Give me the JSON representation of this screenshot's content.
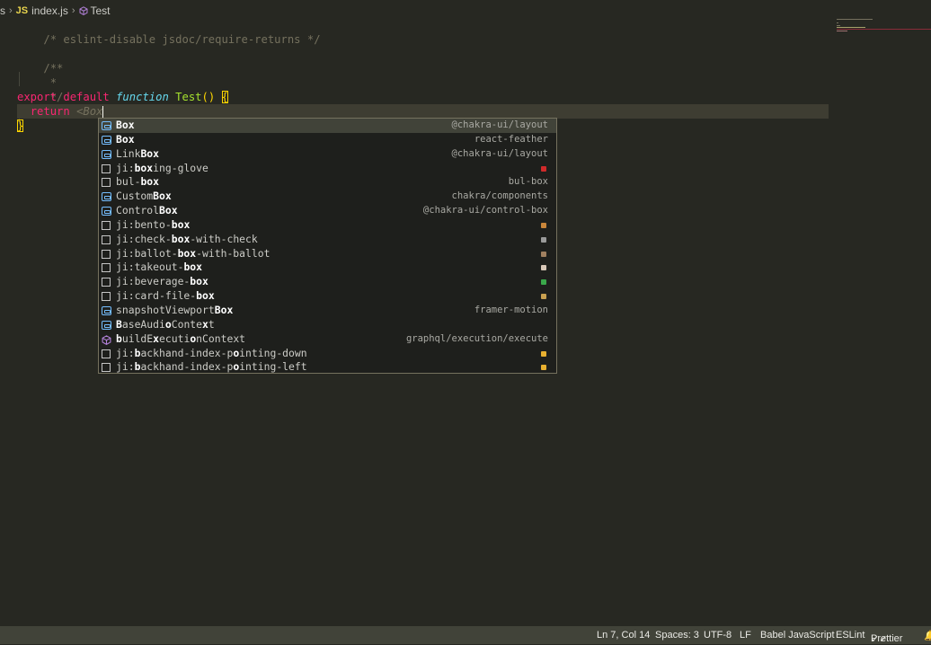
{
  "breadcrumb": {
    "lead": "s",
    "file_badge": "JS",
    "file": "index.js",
    "symbol": "Test"
  },
  "code": {
    "line1": "/* eslint-disable jsdoc/require-returns */",
    "line3": "/**",
    "line4": " *",
    "line5": " */",
    "export_kw": "export",
    "default_kw": "default",
    "function_kw": "function",
    "fn_name": "Test",
    "parens": "()",
    "open_brace": "{",
    "return_kw": "return",
    "tag_open": "<",
    "tag_name": "Box",
    "close_brace": "}"
  },
  "suggestions": [
    {
      "pre": "",
      "bold": "Box",
      "post": "",
      "source": "@chakra-ui/layout",
      "icon": "reference-icon",
      "selected": true
    },
    {
      "pre": "",
      "bold": "Box",
      "post": "",
      "source": "react-feather",
      "icon": "reference-icon"
    },
    {
      "pre": "Link",
      "bold": "Box",
      "post": "",
      "source": "@chakra-ui/layout",
      "icon": "reference-icon"
    },
    {
      "pre": "ji:",
      "bold": "box",
      "post": "ing-glove",
      "source": "",
      "icon": "text-icon",
      "emoji_color": "#d02a2a"
    },
    {
      "pre": "bul-",
      "bold": "box",
      "post": "",
      "source": "bul-box",
      "icon": "text-icon"
    },
    {
      "pre": "Custom",
      "bold": "Box",
      "post": "",
      "source": "chakra/components",
      "icon": "reference-icon"
    },
    {
      "pre": "Control",
      "bold": "Box",
      "post": "",
      "source": "@chakra-ui/control-box",
      "icon": "reference-icon"
    },
    {
      "pre": "ji:bento-",
      "bold": "box",
      "post": "",
      "source": "",
      "icon": "text-icon",
      "emoji_color": "#c9863a"
    },
    {
      "pre": "ji:check-",
      "bold": "box",
      "post": "-with-check",
      "source": "",
      "icon": "text-icon",
      "emoji_color": "#9a9a9a"
    },
    {
      "pre": "ji:ballot-",
      "bold": "box",
      "post": "-with-ballot",
      "source": "",
      "icon": "text-icon",
      "emoji_color": "#a08060"
    },
    {
      "pre": "ji:takeout-",
      "bold": "box",
      "post": "",
      "source": "",
      "icon": "text-icon",
      "emoji_color": "#d8c8b8"
    },
    {
      "pre": "ji:beverage-",
      "bold": "box",
      "post": "",
      "source": "",
      "icon": "text-icon",
      "emoji_color": "#3aa84a"
    },
    {
      "pre": "ji:card-file-",
      "bold": "box",
      "post": "",
      "source": "",
      "icon": "text-icon",
      "emoji_color": "#c8a050"
    },
    {
      "pre": "snapshotViewport",
      "bold": "Box",
      "post": "",
      "source": "framer-motion",
      "icon": "reference-icon"
    },
    {
      "segments": [
        [
          "B",
          1
        ],
        [
          "aseAudi",
          0
        ],
        [
          "o",
          1
        ],
        [
          "Conte",
          0
        ],
        [
          "x",
          1
        ],
        [
          "t",
          0
        ]
      ],
      "source": "",
      "icon": "reference-icon"
    },
    {
      "segments": [
        [
          "b",
          1
        ],
        [
          "uildE",
          0
        ],
        [
          "x",
          1
        ],
        [
          "ecuti",
          0
        ],
        [
          "o",
          1
        ],
        [
          "nContext",
          0
        ]
      ],
      "source": "graphql/execution/execute",
      "icon": "method-icon"
    },
    {
      "segments": [
        [
          "ji:",
          0
        ],
        [
          "b",
          1
        ],
        [
          "ackhand-index-p",
          0
        ],
        [
          "o",
          1
        ],
        [
          "inting-down",
          0
        ]
      ],
      "source": "",
      "icon": "text-icon",
      "emoji_color": "#e8b030"
    },
    {
      "segments": [
        [
          "ji:",
          0
        ],
        [
          "b",
          1
        ],
        [
          "ackhand-index-p",
          0
        ],
        [
          "o",
          1
        ],
        [
          "inting-left",
          0
        ]
      ],
      "source": "",
      "icon": "text-icon",
      "emoji_color": "#e8b030"
    }
  ],
  "status": {
    "position": "Ln 7, Col 14",
    "spaces": "Spaces: 3",
    "encoding": "UTF-8",
    "eol": "LF",
    "language": "Babel JavaScript",
    "linter": "ESLint",
    "formatter": "Prettier"
  },
  "colors": {
    "editor_bg": "#272822",
    "current_line": "#3e3d32",
    "keyword": "#f92672",
    "function": "#a6e22e",
    "storage": "#66d9ef",
    "comment": "#75715e",
    "bracket": "#ffd700",
    "status_bg": "#414339"
  }
}
